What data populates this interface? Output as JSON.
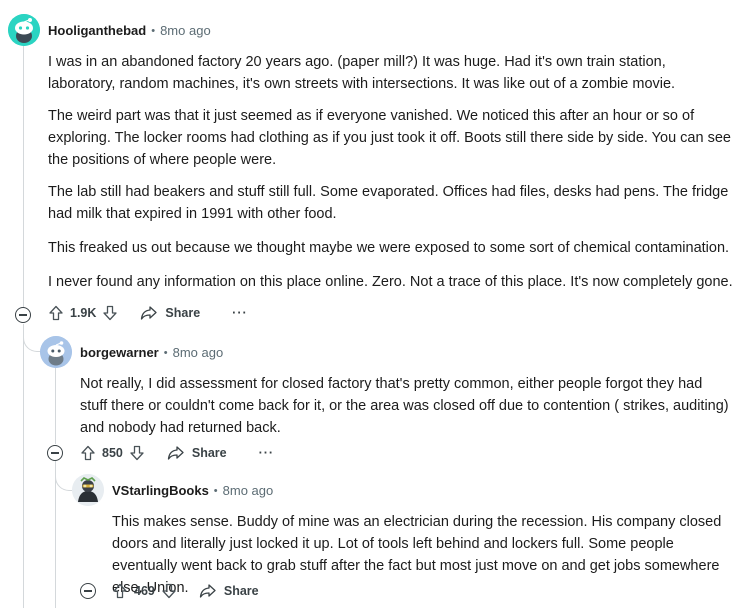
{
  "comments": [
    {
      "author": "Hooliganthebad",
      "age": "8mo ago",
      "paragraphs": [
        "I was in an abandoned factory 20 years ago. (paper mill?) It was huge. Had it's own train station, laboratory, random machines, it's own streets with intersections. It was like out of a zombie movie.",
        "The weird part was that it just seemed as if everyone vanished. We noticed this after an hour or so of exploring. The locker rooms had clothing as if you just took it off. Boots still there side by side. You can see the positions of where people were.",
        "The lab still had beakers and stuff still full. Some evaporated. Offices had files, desks had pens. The fridge had milk that expired in 1991 with other food.",
        "This freaked us out because we thought maybe we were exposed to some sort of chemical contamination.",
        "I never found any information on this place online. Zero. Not a trace of this place. It's now completely gone."
      ],
      "votes": "1.9K",
      "share_label": "Share",
      "more_label": "···"
    },
    {
      "author": "borgewarner",
      "age": "8mo ago",
      "paragraphs": [
        "Not really, I did assessment for closed factory that's pretty common, either people forgot they had stuff there or couldn't come back for it, or the area was closed off due to contention ( strikes, auditing) and nobody had returned back."
      ],
      "votes": "850",
      "share_label": "Share",
      "more_label": "···"
    },
    {
      "author": "VStarlingBooks",
      "age": "8mo ago",
      "paragraphs": [
        "This makes sense. Buddy of mine was an electrician during the recession. His company closed doors and literally just locked it up. Lot of tools left behind and lockers full. Some people eventually went back to grab stuff after the fact but most just move on and get jobs somewhere else. Union."
      ],
      "votes": "469",
      "share_label": "Share",
      "more_label": ""
    }
  ],
  "separator": "•",
  "colors": {
    "text": "#1c1c1c",
    "meta": "#5c6c74",
    "thread_line": "#d4d8db",
    "avatar_teal": "#2bd4c2",
    "avatar_blue": "#a8c4e8"
  },
  "icons": [
    "upvote-icon",
    "downvote-icon",
    "share-icon",
    "collapse-icon",
    "more-icon"
  ]
}
